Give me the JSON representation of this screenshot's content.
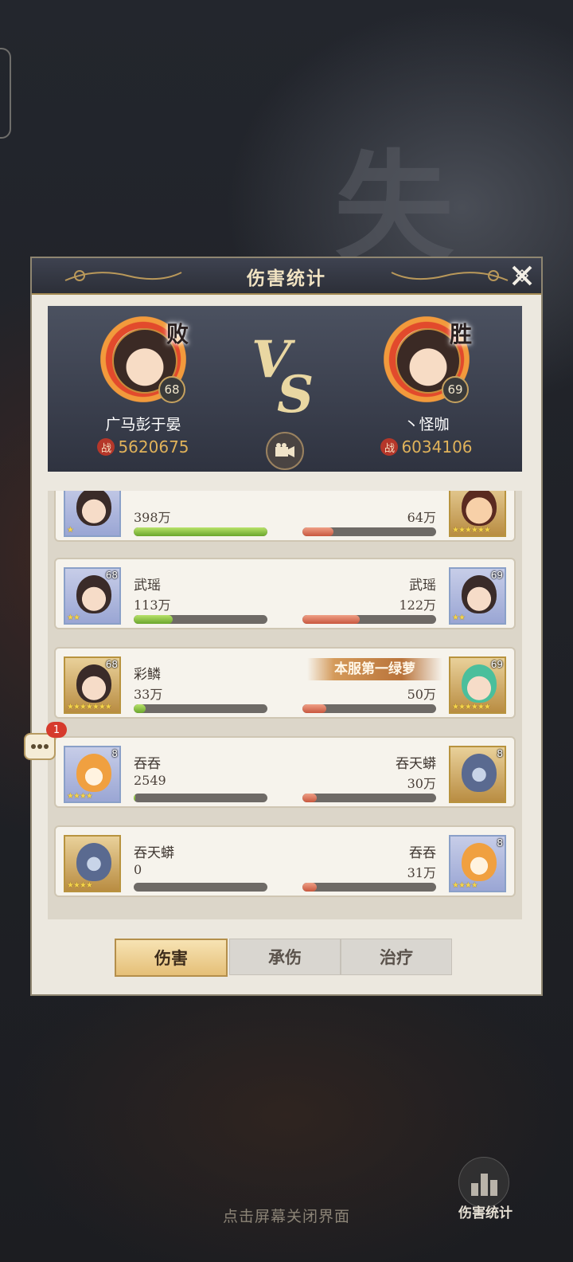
{
  "background": {
    "watermark": "失"
  },
  "dialog": {
    "title": "伤害统计",
    "close_icon": "close-x-icon"
  },
  "players": {
    "left": {
      "name": "广马彭于晏",
      "result": "败",
      "level": "68",
      "power_label": "战",
      "power": "5620675"
    },
    "right": {
      "name": "丶怪咖",
      "result": "胜",
      "level": "69",
      "power_label": "战",
      "power": "6034106"
    }
  },
  "vs": {
    "v": "V",
    "s": "S"
  },
  "rows": [
    {
      "left": {
        "name": "",
        "value": "398万",
        "level": "",
        "stars": "★"
      },
      "right": {
        "name": "",
        "value": "64万",
        "level": "",
        "stars": "★★★★★★"
      },
      "left_fill": 1.0,
      "right_fill": 0.23
    },
    {
      "left": {
        "name": "武瑶",
        "value": "113万",
        "level": "68",
        "stars": "★★"
      },
      "right": {
        "name": "武瑶",
        "value": "122万",
        "level": "69",
        "stars": "★★"
      },
      "left_fill": 0.29,
      "right_fill": 0.43
    },
    {
      "left": {
        "name": "彩鳞",
        "value": "33万",
        "level": "68",
        "stars": "★★★★★★★"
      },
      "right": {
        "name": "",
        "value": "50万",
        "level": "69",
        "stars": "★★★★★★"
      },
      "left_fill": 0.09,
      "right_fill": 0.18,
      "right_title": "本服第一绿萝"
    },
    {
      "left": {
        "name": "吞吞",
        "value": "2549",
        "level": "8",
        "stars": "★★★★"
      },
      "right": {
        "name": "吞天蟒",
        "value": "30万",
        "level": "8",
        "stars": ""
      },
      "left_fill": 0.01,
      "right_fill": 0.11
    },
    {
      "left": {
        "name": "吞天蟒",
        "value": "0",
        "level": "",
        "stars": "★★★★"
      },
      "right": {
        "name": "吞吞",
        "value": "31万",
        "level": "8",
        "stars": "★★★★"
      },
      "left_fill": 0.0,
      "right_fill": 0.11
    }
  ],
  "tabs": [
    "伤害",
    "承伤",
    "治疗"
  ],
  "active_tab": "伤害",
  "chat": {
    "count": "1"
  },
  "footer": {
    "hint": "点击屏幕关闭界面",
    "stats_button": "伤害统计"
  }
}
